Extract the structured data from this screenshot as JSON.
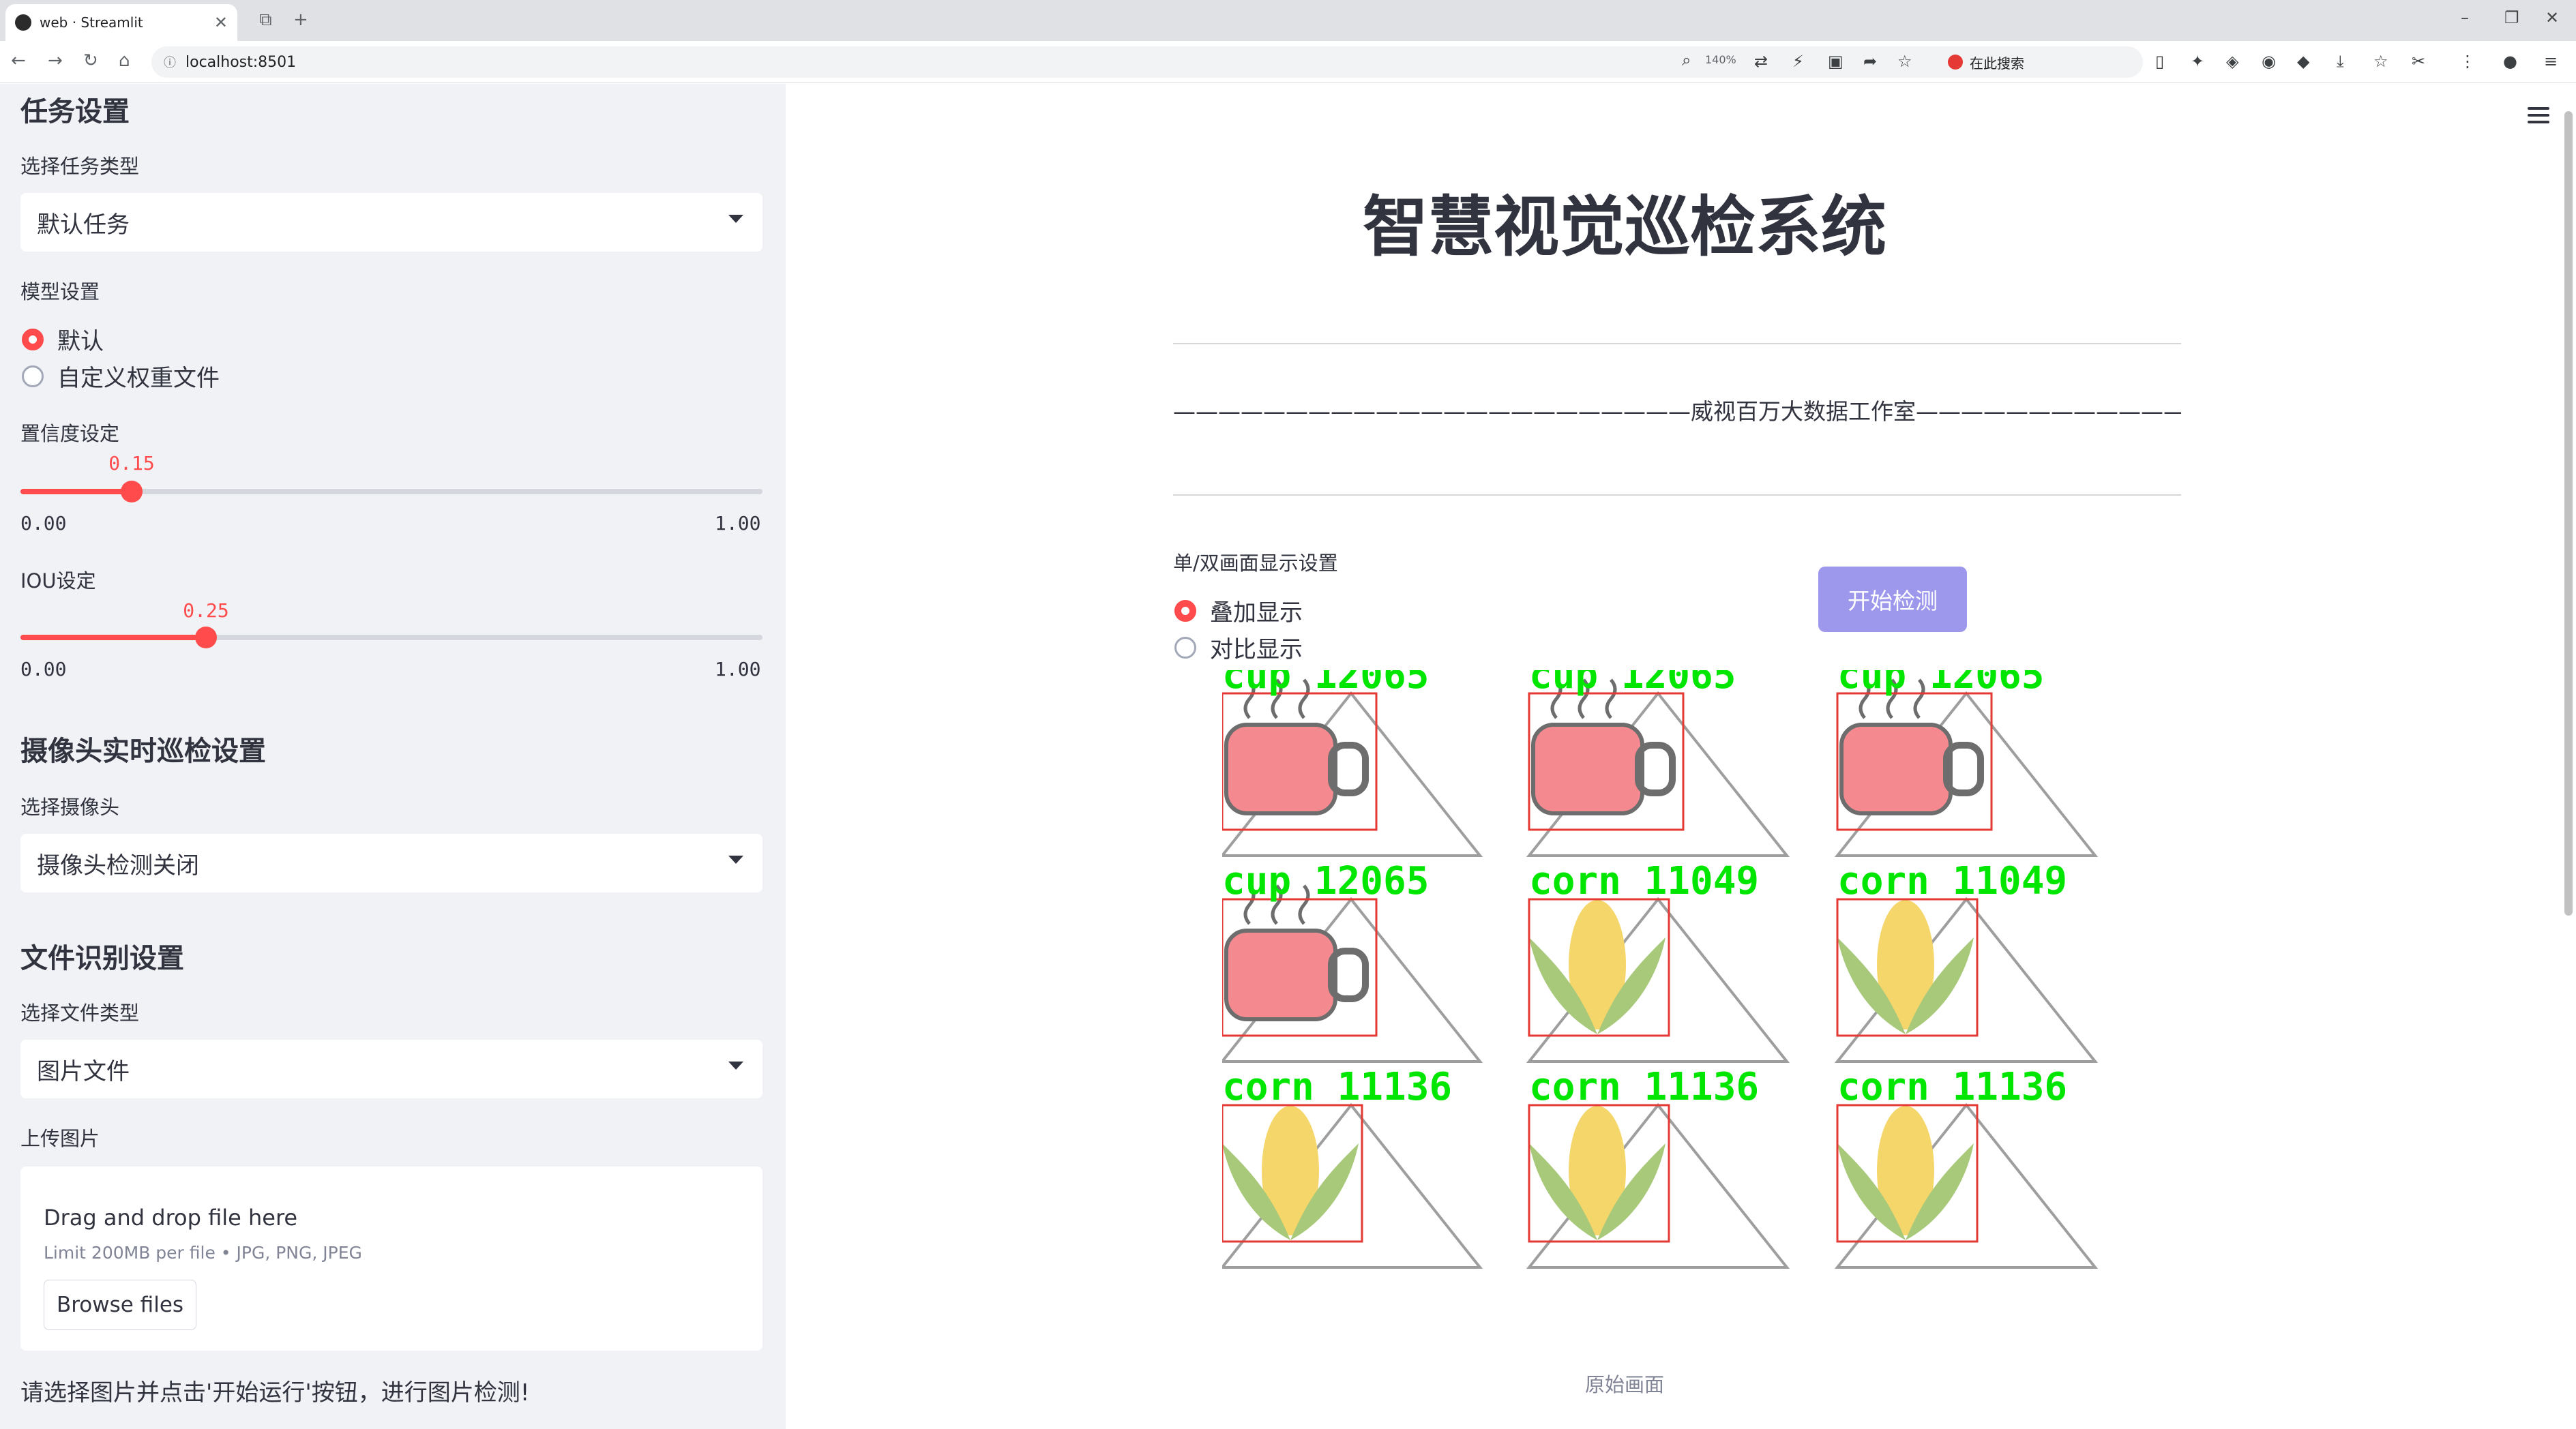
{
  "browser": {
    "tab_title": "web · Streamlit",
    "url": "localhost:8501",
    "zoom": "140%",
    "search_placeholder": "在此搜索"
  },
  "sidebar": {
    "task_section": "任务设置",
    "task_type_label": "选择任务类型",
    "task_type_value": "默认任务",
    "model_label": "模型设置",
    "model_options": [
      "默认",
      "自定义权重文件"
    ],
    "model_selected": 0,
    "conf_label": "置信度设定",
    "conf_value": "0.15",
    "conf_min": "0.00",
    "conf_max": "1.00",
    "iou_label": "IOU设定",
    "iou_value": "0.25",
    "iou_min": "0.00",
    "iou_max": "1.00",
    "camera_section": "摄像头实时巡检设置",
    "camera_label": "选择摄像头",
    "camera_value": "摄像头检测关闭",
    "file_section": "文件识别设置",
    "file_type_label": "选择文件类型",
    "file_type_value": "图片文件",
    "upload_label": "上传图片",
    "dropzone_text": "Drag and drop file here",
    "dropzone_limit": "Limit 200MB per file • JPG, PNG, JPEG",
    "browse_label": "Browse files",
    "footer_note": "请选择图片并点击'开始运行'按钮，进行图片检测!"
  },
  "main": {
    "title": "智慧视觉巡检系统",
    "studio": "———————————————————————威视百万大数据工作室———————————————————————",
    "display_label": "单/双画面显示设置",
    "display_options": [
      "叠加显示",
      "对比显示"
    ],
    "display_selected": 0,
    "start_button": "开始检测",
    "detections": [
      {
        "label": "cup  12065",
        "kind": "cup"
      },
      {
        "label": "cup  12065",
        "kind": "cup"
      },
      {
        "label": "cup  12065",
        "kind": "cup"
      },
      {
        "label": "cup  12065",
        "kind": "cup"
      },
      {
        "label": "corn  11049",
        "kind": "corn"
      },
      {
        "label": "corn  11049",
        "kind": "corn"
      },
      {
        "label": "corn  11136",
        "kind": "corn"
      },
      {
        "label": "corn  11136",
        "kind": "corn"
      },
      {
        "label": "corn  11136",
        "kind": "corn"
      }
    ],
    "caption": "原始画面"
  },
  "colors": {
    "accent": "#ff4b4b",
    "button": "#9e98ec",
    "sidebar_bg": "#f0f2f6",
    "detect_label": "#00e600",
    "detect_box": "#e53935"
  }
}
